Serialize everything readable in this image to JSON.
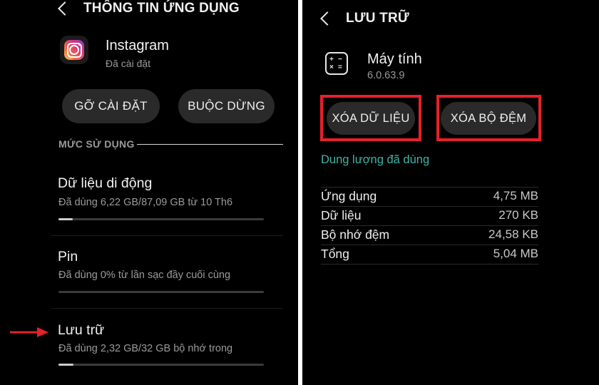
{
  "left": {
    "header": {
      "title": "THÔNG TIN ỨNG DỤNG"
    },
    "app": {
      "name": "Instagram",
      "status": "Đã cài đặt",
      "icon": "instagram-icon"
    },
    "buttons": {
      "uninstall": "GỠ CÀI ĐẶT",
      "force_stop": "BUỘC DỪNG"
    },
    "section": "MỨC SỬ DỤNG",
    "items": [
      {
        "title": "Dữ liệu di động",
        "sub": "Đã dùng 6,22 GB/87,09 GB từ 10 Th6",
        "progress": 0.07
      },
      {
        "title": "Pin",
        "sub": "Đã dùng 0% từ lần sạc đầy cuối cùng",
        "progress": 0
      },
      {
        "title": "Lưu trữ",
        "sub": "Đã dùng 2,32 GB/32 GB bộ nhớ trong",
        "progress": 0.0725
      }
    ]
  },
  "right": {
    "header": {
      "title": "LƯU TRỮ"
    },
    "app": {
      "name": "Máy tính",
      "version": "6.0.63.9",
      "icon": "calculator-icon"
    },
    "buttons": {
      "clear_data": "XÓA DỮ LIỆU",
      "clear_cache": "XÓA BỘ ĐỆM"
    },
    "section": "Dung lượng đã dùng",
    "rows": [
      {
        "label": "Ứng dụng",
        "value": "4,75 MB"
      },
      {
        "label": "Dữ liệu",
        "value": "270 KB"
      },
      {
        "label": "Bộ nhớ đệm",
        "value": "24,58 KB"
      },
      {
        "label": "Tổng",
        "value": "5,04 MB"
      }
    ]
  },
  "colors": {
    "background": "#000000",
    "button": "#2a2a2a",
    "accent": "#3fb3a6",
    "highlight": "#e5202a"
  }
}
